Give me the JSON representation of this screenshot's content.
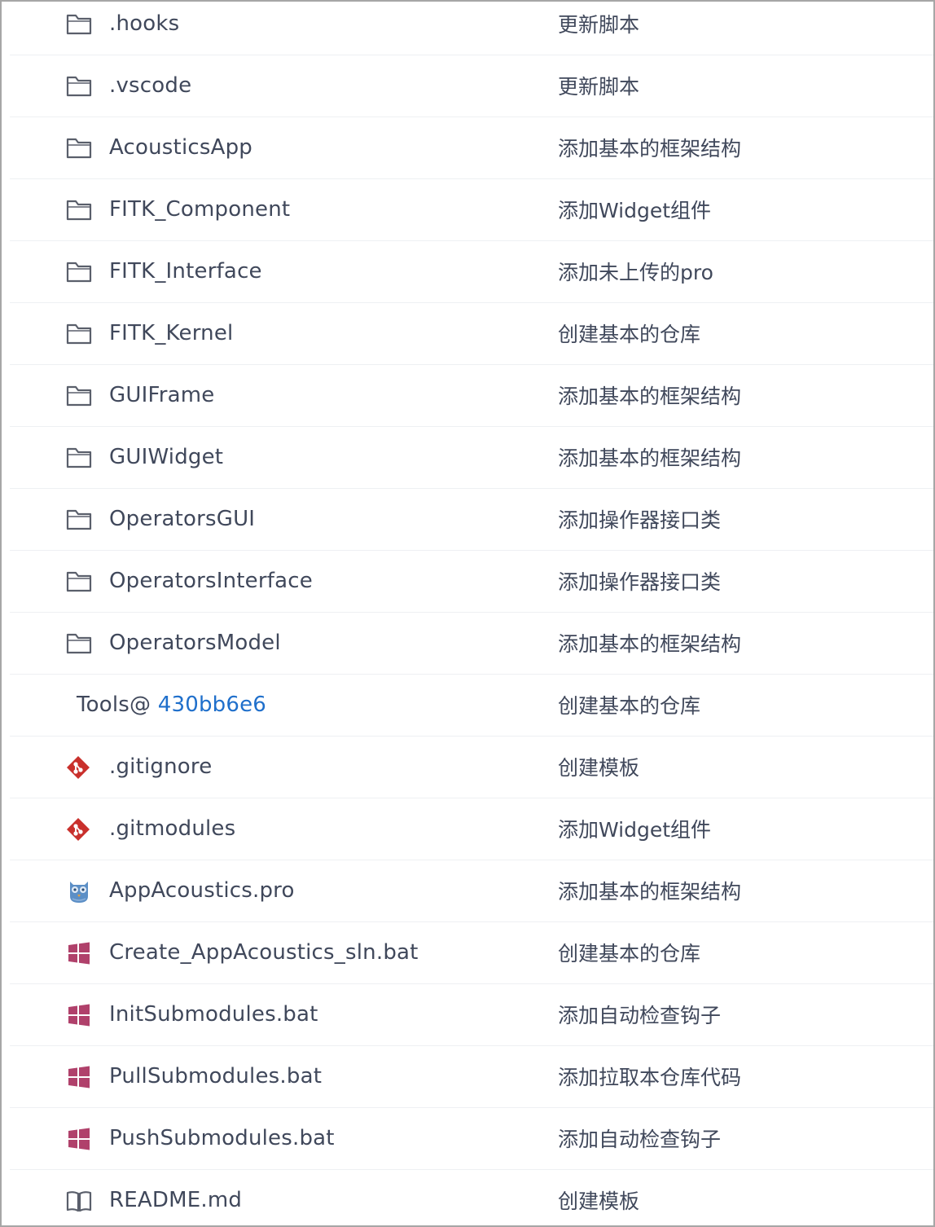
{
  "colors": {
    "text": "#40485b",
    "submodule_link": "#1f6fcb",
    "folder_icon": "#5a5f6b",
    "git_icon": "#c9302c",
    "bat_icon": "#b0416b",
    "qt_icon": "#5c8fc6"
  },
  "files": [
    {
      "name": ".hooks",
      "commit": "更新脚本",
      "icon": "folder-icon"
    },
    {
      "name": ".vscode",
      "commit": "更新脚本",
      "icon": "folder-icon"
    },
    {
      "name": "AcousticsApp",
      "commit": "添加基本的框架结构",
      "icon": "folder-icon"
    },
    {
      "name": "FITK_Component",
      "commit": "添加Widget组件",
      "icon": "folder-icon"
    },
    {
      "name": "FITK_Interface",
      "commit": "添加未上传的pro",
      "icon": "folder-icon"
    },
    {
      "name": "FITK_Kernel",
      "commit": "创建基本的仓库",
      "icon": "folder-icon"
    },
    {
      "name": "GUIFrame",
      "commit": "添加基本的框架结构",
      "icon": "folder-icon"
    },
    {
      "name": "GUIWidget",
      "commit": "添加基本的框架结构",
      "icon": "folder-icon"
    },
    {
      "name": "OperatorsGUI",
      "commit": "添加操作器接口类",
      "icon": "folder-icon"
    },
    {
      "name": "OperatorsInterface",
      "commit": "添加操作器接口类",
      "icon": "folder-icon"
    },
    {
      "name": "OperatorsModel",
      "commit": "添加基本的框架结构",
      "icon": "folder-icon"
    },
    {
      "name": "Tools@",
      "hash": "430bb6e6",
      "commit": "创建基本的仓库",
      "icon": "none"
    },
    {
      "name": ".gitignore",
      "commit": "创建模板",
      "icon": "git-icon"
    },
    {
      "name": ".gitmodules",
      "commit": "添加Widget组件",
      "icon": "git-icon"
    },
    {
      "name": "AppAcoustics.pro",
      "commit": "添加基本的框架结构",
      "icon": "qt-project-icon"
    },
    {
      "name": "Create_AppAcoustics_sln.bat",
      "commit": "创建基本的仓库",
      "icon": "windows-batch-icon"
    },
    {
      "name": "InitSubmodules.bat",
      "commit": "添加自动检查钩子",
      "icon": "windows-batch-icon"
    },
    {
      "name": "PullSubmodules.bat",
      "commit": "添加拉取本仓库代码",
      "icon": "windows-batch-icon"
    },
    {
      "name": "PushSubmodules.bat",
      "commit": "添加自动检查钩子",
      "icon": "windows-batch-icon"
    },
    {
      "name": "README.md",
      "commit": "创建模板",
      "icon": "book-icon"
    }
  ]
}
